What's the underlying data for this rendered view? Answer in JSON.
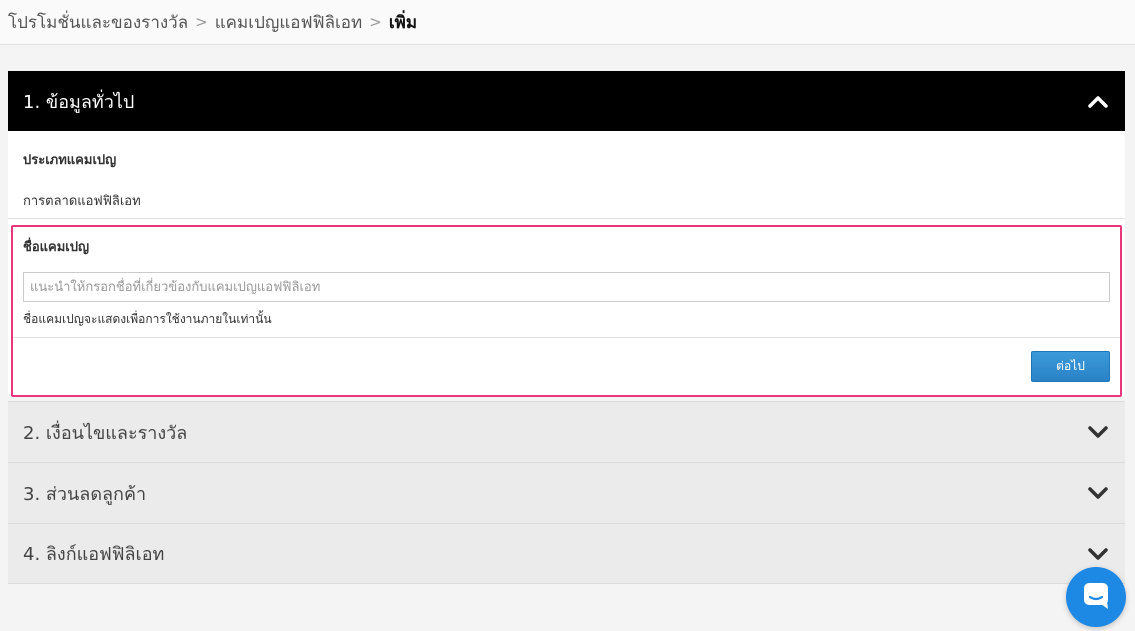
{
  "breadcrumb": {
    "items": [
      "โปรโมชั่นและของรางวัล",
      "แคมเปญแอฟฟิลิเอท"
    ],
    "current": "เพิ่ม"
  },
  "sections": {
    "general": {
      "title": "1. ข้อมูลทั่วไป"
    },
    "conditions": {
      "title": "2. เงื่อนไขและรางวัล"
    },
    "discount": {
      "title": "3. ส่วนลดลูกค้า"
    },
    "link": {
      "title": "4. ลิงก์แอฟฟิลิเอท"
    }
  },
  "campaign_type": {
    "label": "ประเภทแคมเปญ",
    "value": "การตลาดแอฟฟิลิเอท"
  },
  "campaign_name": {
    "label": "ชื่อแคมเปญ",
    "placeholder": "แนะนำให้กรอกชื่อที่เกี่ยวข้องกับแคมเปญแอฟฟิลิเอท",
    "value": "",
    "hint": "ชื่อแคมเปญจะแสดงเพื่อการใช้งานภายในเท่านั้น"
  },
  "next_button": {
    "label": "ต่อไป"
  },
  "colors": {
    "accent": "#2a82c7",
    "highlight": "#e8377a",
    "header": "#000000"
  },
  "icons": {
    "expanded": "chevron-up-icon",
    "collapsed": "chevron-down-icon",
    "chat": "chat-bubble-icon"
  }
}
